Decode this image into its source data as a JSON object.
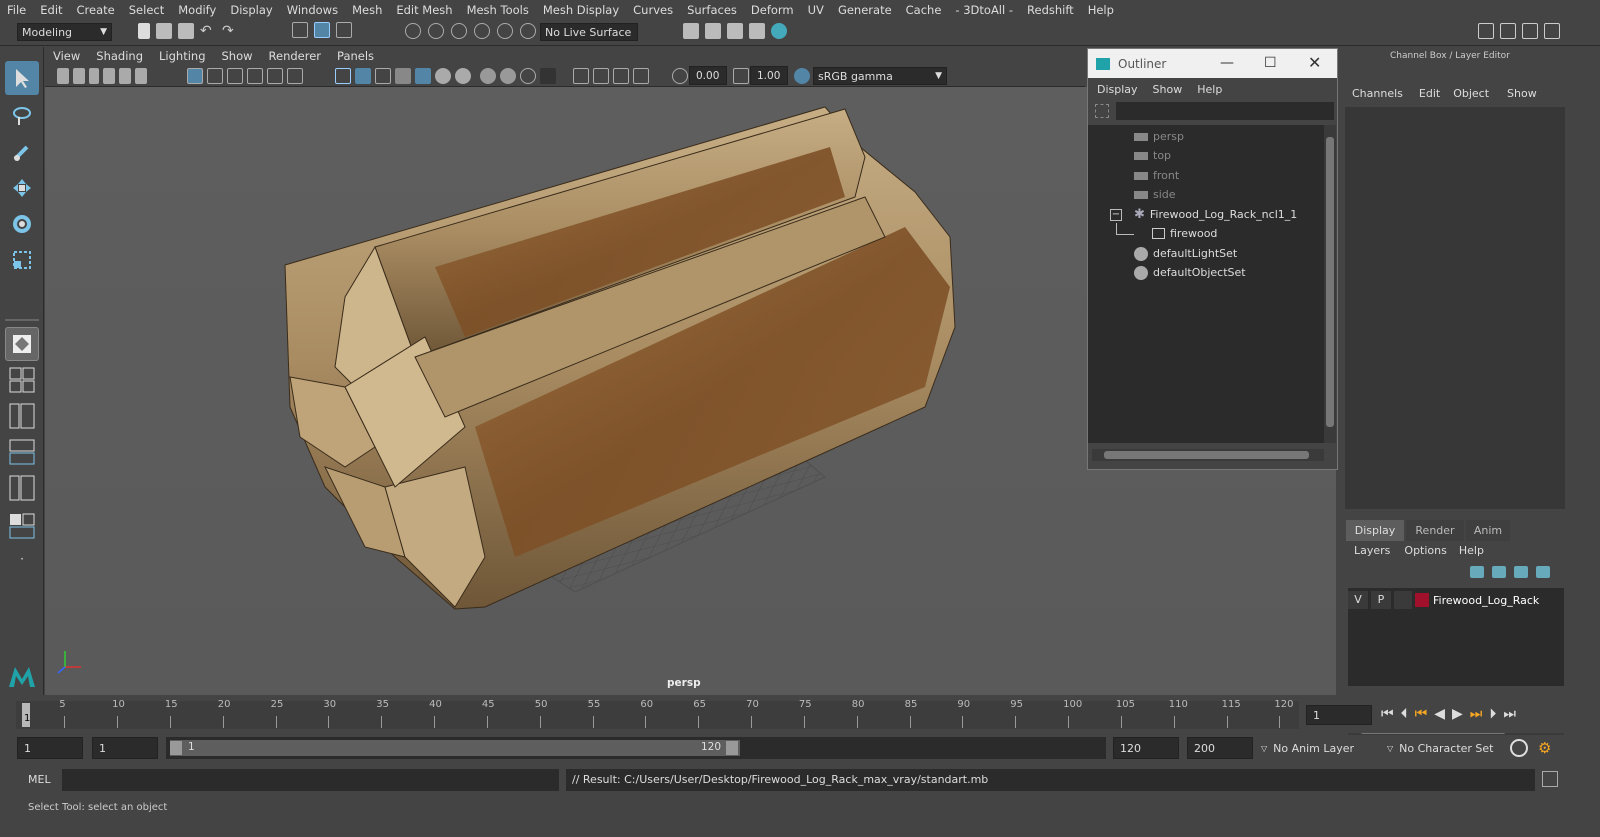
{
  "menubar": {
    "items": [
      "File",
      "Edit",
      "Create",
      "Select",
      "Modify",
      "Display",
      "Windows",
      "Mesh",
      "Edit Mesh",
      "Mesh Tools",
      "Mesh Display",
      "Curves",
      "Surfaces",
      "Deform",
      "UV",
      "Generate",
      "Cache",
      "- 3DtoAll -",
      "Redshift",
      "Help"
    ]
  },
  "status": {
    "mode": "Modeling",
    "live_surface": "No Live Surface"
  },
  "panel_menu": {
    "items": [
      "View",
      "Shading",
      "Lighting",
      "Show",
      "Renderer",
      "Panels"
    ]
  },
  "viewport": {
    "exposure": "0.00",
    "gamma": "1.00",
    "color_space": "sRGB gamma",
    "camera_label": "persp"
  },
  "outliner": {
    "title": "Outliner",
    "menu": [
      "Display",
      "Show",
      "Help"
    ],
    "items": [
      "persp",
      "top",
      "front",
      "side",
      "Firewood_Log_Rack_ncl1_1",
      "firewood",
      "defaultLightSet",
      "defaultObjectSet"
    ]
  },
  "channelbox": {
    "title": "Channel Box / Layer Editor",
    "menu": [
      "Channels",
      "Edit",
      "Object",
      "Show"
    ],
    "tabs": [
      "Display",
      "Render",
      "Anim"
    ],
    "layer_menu": [
      "Layers",
      "Options",
      "Help"
    ],
    "layer": {
      "v": "V",
      "p": "P",
      "name": "Firewood_Log_Rack",
      "color": "#a0102a"
    }
  },
  "timeline": {
    "ticks": [
      "5",
      "10",
      "15",
      "20",
      "25",
      "30",
      "35",
      "40",
      "45",
      "50",
      "55",
      "60",
      "65",
      "70",
      "75",
      "80",
      "85",
      "90",
      "95",
      "100",
      "105",
      "110",
      "115",
      "120"
    ],
    "current_marker": "1",
    "current_frame": "1"
  },
  "range": {
    "start": "1",
    "inner_start": "1",
    "slider_start": "1",
    "slider_end": "120",
    "end": "120",
    "total_end": "200",
    "anim_layer": "No Anim Layer",
    "char_set": "No Character Set"
  },
  "mel": {
    "label": "MEL",
    "result": "// Result: C:/Users/User/Desktop/Firewood_Log_Rack_max_vray/standart.mb"
  },
  "help_line": "Select Tool: select an object"
}
